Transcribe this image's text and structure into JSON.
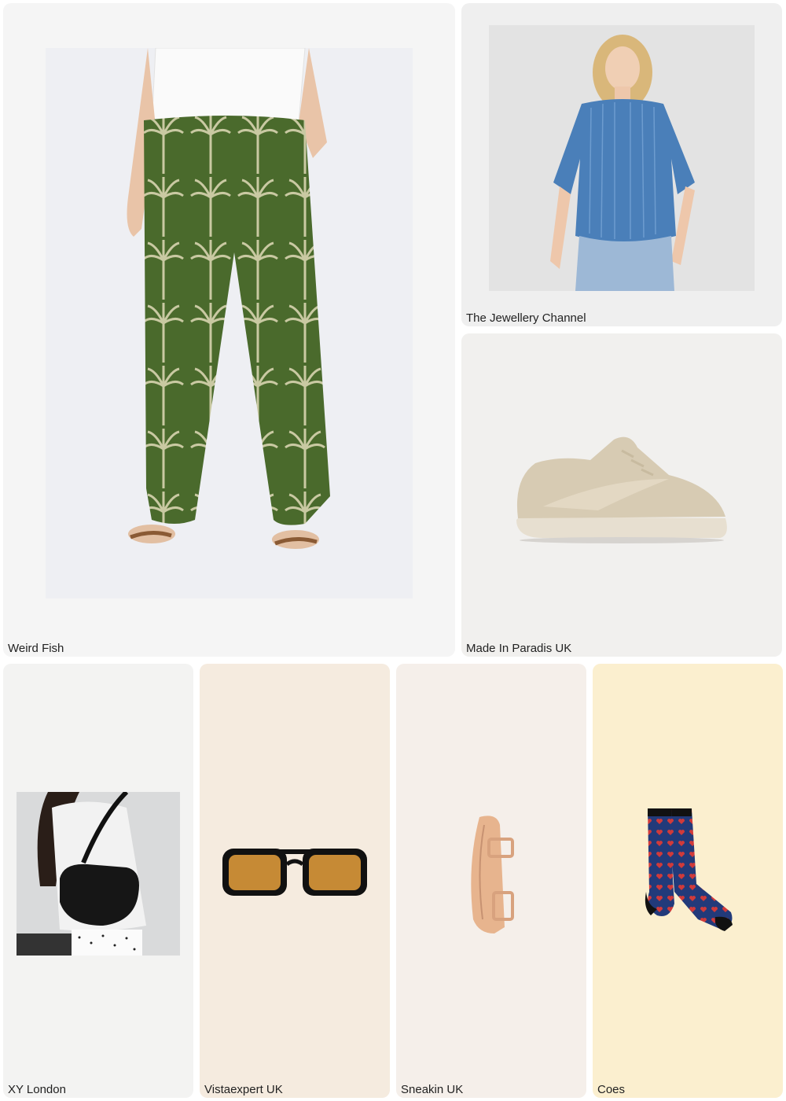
{
  "products": {
    "pants": {
      "brand": "Weird Fish",
      "icon": "palm-print-pants-photo",
      "bg": "#f5f5f5"
    },
    "shirt": {
      "brand": "The Jewellery Channel",
      "icon": "denim-shirt-photo",
      "bg": "#efefef"
    },
    "sneaker": {
      "brand": "Made In Paradis UK",
      "icon": "beige-sneaker-photo",
      "bg": "#f1f0ee"
    },
    "bag": {
      "brand": "XY London",
      "icon": "black-shoulder-bag-photo",
      "bg": "#f3f3f2"
    },
    "sunglasses": {
      "brand": "Vistaexpert UK",
      "icon": "amber-sunglasses-photo",
      "bg": "#f5ebdf"
    },
    "strap": {
      "brand": "Sneakin UK",
      "icon": "leather-watch-strap-photo",
      "bg": "#f5efea"
    },
    "socks": {
      "brand": "Coes",
      "icon": "heart-socks-photo",
      "bg": "#fbefcf"
    }
  }
}
